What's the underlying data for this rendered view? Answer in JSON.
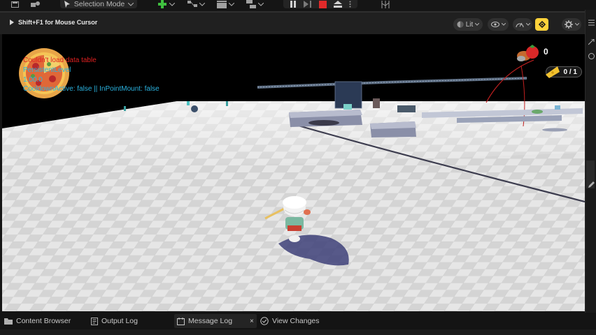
{
  "toolbar": {
    "selection_mode": "Selection Mode"
  },
  "viewport_header": {
    "hint": "Shift+F1 for Mouse Cursor",
    "view_mode": "Lit"
  },
  "debug_messages": {
    "error": "Couldn't load data table",
    "level": "PersistentLevel",
    "version": "1.00.0",
    "cooldown": "CooldownActive: false || InPointMount: false"
  },
  "hud": {
    "food_count": "0",
    "cheese_counter": "0 / 1"
  },
  "dock": {
    "tabs": [
      {
        "label": "Content Browser"
      },
      {
        "label": "Output Log"
      },
      {
        "label": "Message Log",
        "close": "×"
      },
      {
        "label": "View Changes"
      }
    ]
  },
  "colors": {
    "error_text": "#e02020",
    "info_text": "#2bb3e0",
    "snap_accent": "#ffd23a",
    "stop_red": "#e02a2a"
  }
}
